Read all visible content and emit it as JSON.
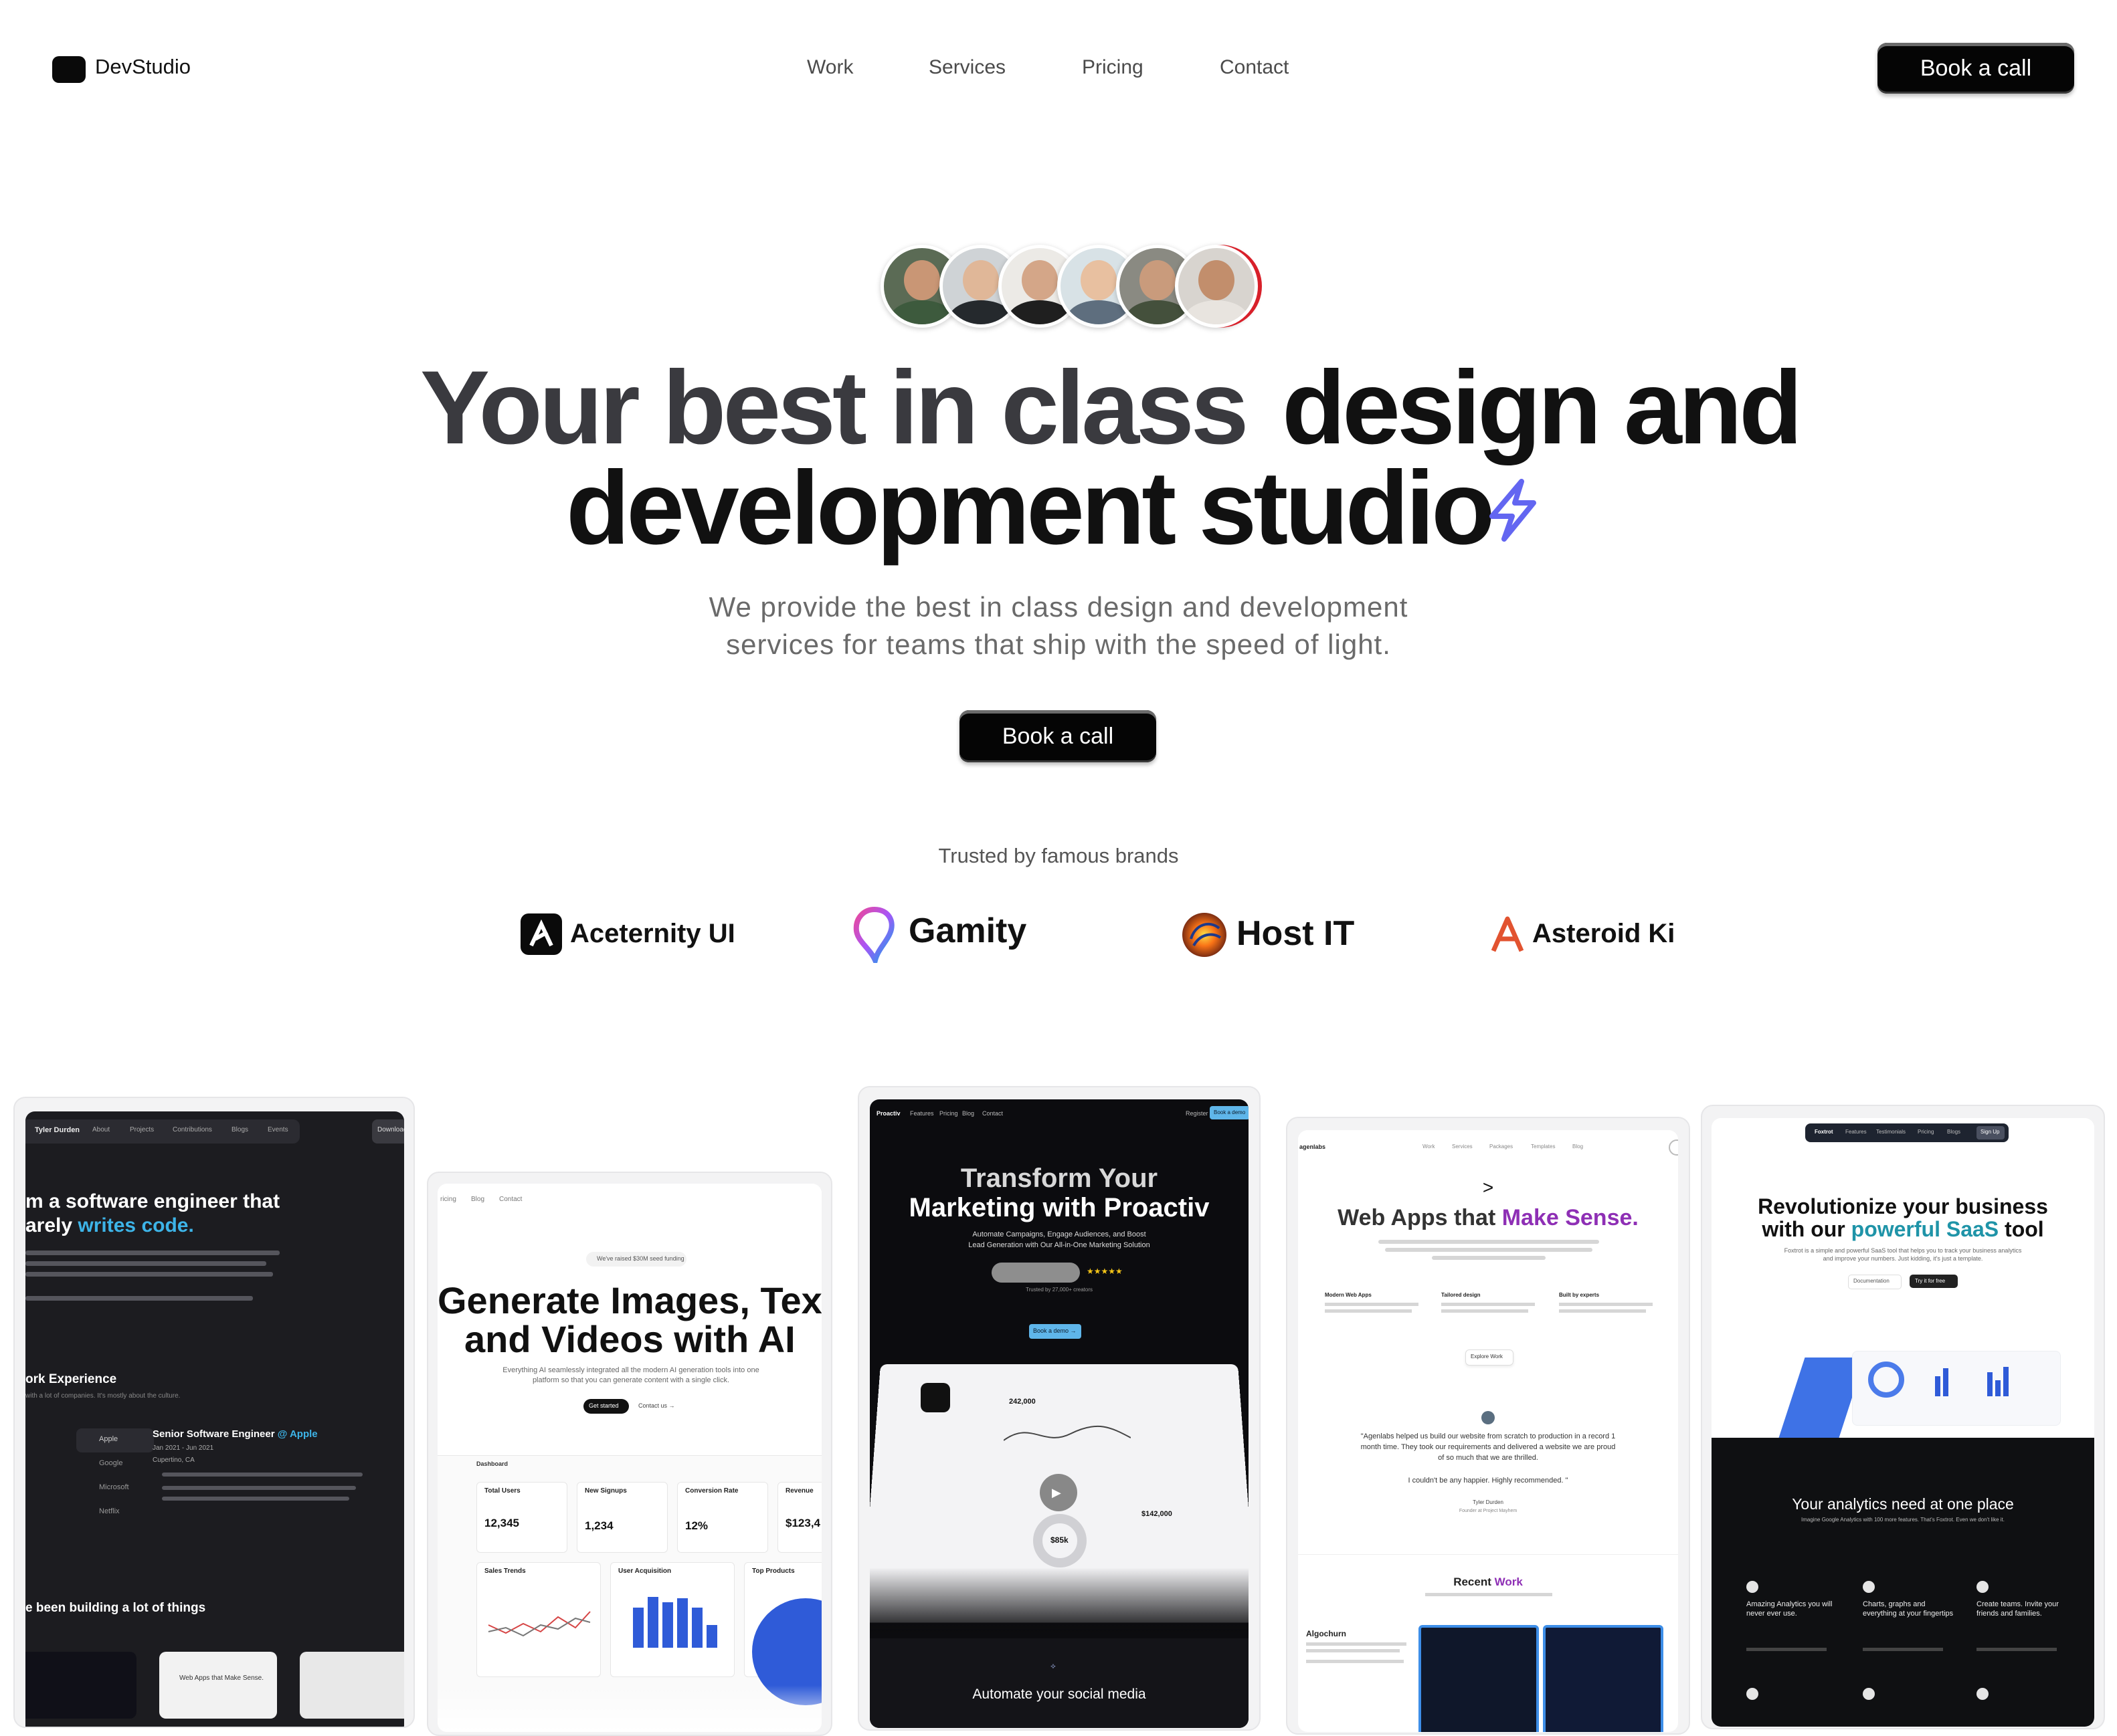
{
  "brand": {
    "name": "DevStudio"
  },
  "nav": {
    "links": [
      "Work",
      "Services",
      "Pricing",
      "Contact"
    ],
    "cta": "Book a call"
  },
  "hero": {
    "title_muted": "Your best in class",
    "title_strong_1": "design and",
    "title_strong_2": "development studio",
    "subtitle_line1": "We provide the best in class design and development",
    "subtitle_line2": "services for teams that ship with the speed of light.",
    "cta": "Book a call",
    "bolt_color": "#6366f1"
  },
  "trusted": {
    "heading": "Trusted by famous brands",
    "brands": [
      "Aceternity UI",
      "Gamity",
      "Host IT",
      "Asteroid Ki"
    ]
  },
  "showcase": {
    "card1": {
      "nav": [
        "Tyler Durden",
        "About",
        "Projects",
        "Contributions",
        "Blogs",
        "Events",
        "Download"
      ],
      "headline_1": "m a software engineer that",
      "headline_2a": "arely ",
      "headline_2b": "writes code.",
      "section_1": "ork Experience",
      "section_1_sub": "with a lot of companies. It's mostly about the culture.",
      "companies": [
        "Apple",
        "Google",
        "Microsoft",
        "Netflix"
      ],
      "role_a": "Senior Software Engineer ",
      "role_b": "@ Apple",
      "dates": "Jan 2021 - Jun 2021",
      "location": "Cupertino, CA",
      "section_2": "e been building a lot of things",
      "thumb_label": "Web Apps that Make Sense."
    },
    "card2": {
      "nav": [
        "ricing",
        "Blog",
        "Contact"
      ],
      "badge": "We've raised $30M seed funding",
      "headline_1": "Generate Images, Tex",
      "headline_2": "and Videos with AI",
      "body": "Everything AI seamlessly integrated all the modern AI generation tools into one platform so that you can generate content with a single click.",
      "btn_primary": "Get started",
      "btn_secondary": "Contact us →",
      "dash_label": "Dashboard",
      "stats": [
        {
          "label": "Total Users",
          "value": "12,345"
        },
        {
          "label": "New Signups",
          "value": "1,234"
        },
        {
          "label": "Conversion Rate",
          "value": "12%"
        },
        {
          "label": "Revenue",
          "value": "$123,4"
        }
      ],
      "panels": [
        "Sales Trends",
        "User Acquisition",
        "Top Products"
      ]
    },
    "card3": {
      "nav": [
        "Proactiv",
        "Features",
        "Pricing",
        "Blog",
        "Contact",
        "Register",
        "Book a demo"
      ],
      "headline_1": "Transform Your",
      "headline_2": "Marketing with Proactiv",
      "body_1": "Automate Campaigns, Engage Audiences, and Boost",
      "body_2": "Lead Generation with Our All-in-One Marketing Solution",
      "trusted": "Trusted by 27,000+ creators",
      "cta": "Book a demo →",
      "amount_1": "242,000",
      "amount_2": "$85k",
      "amount_3": "$142,000",
      "footer": "Automate your social media"
    },
    "card4": {
      "logo": "agenlabs",
      "nav": [
        "Work",
        "Services",
        "Packages",
        "Templates",
        "Blog"
      ],
      "chevron": ">",
      "headline_a": "Web Apps that ",
      "headline_b": "Make Sense.",
      "features": [
        "Modern Web Apps",
        "Tailored design",
        "Built by experts"
      ],
      "explore": "Explore Work",
      "quote_1": "\"Agenlabs helped us build our website from scratch to production in a record 1",
      "quote_2": "month time. They took our requirements and delivered a website we are proud",
      "quote_3": "of so much that we are thrilled.",
      "quote_4": "I couldn't be any happier. Highly recommended. \"",
      "author": "Tyler Durden",
      "author_role": "Founder at Project Mayhem",
      "recent_a": "Recent ",
      "recent_b": "Work",
      "project": "Algochurn"
    },
    "card5": {
      "nav": [
        "Foxtrot",
        "Features",
        "Testimonials",
        "Pricing",
        "Blogs",
        "Sign Up"
      ],
      "headline_1": "Revolutionize your business",
      "headline_2a": "with our ",
      "headline_2b": "powerful SaaS",
      "headline_2c": " tool",
      "body": "Foxtrot is a simple and powerful SaaS tool that helps you to track your business analytics and improve your numbers. Just kidding, it's just a template.",
      "btn_doc": "Documentation",
      "btn_try": "Try it for free",
      "section": "Your analytics need at one place",
      "section_sub": "Imagine Google Analytics with 100 more features. That's Foxtrot. Even we don't like it.",
      "features": [
        "Amazing Analytics you will never ever use.",
        "Charts, graphs and everything at your fingertips",
        "Create teams. Invite your friends and families."
      ]
    }
  }
}
